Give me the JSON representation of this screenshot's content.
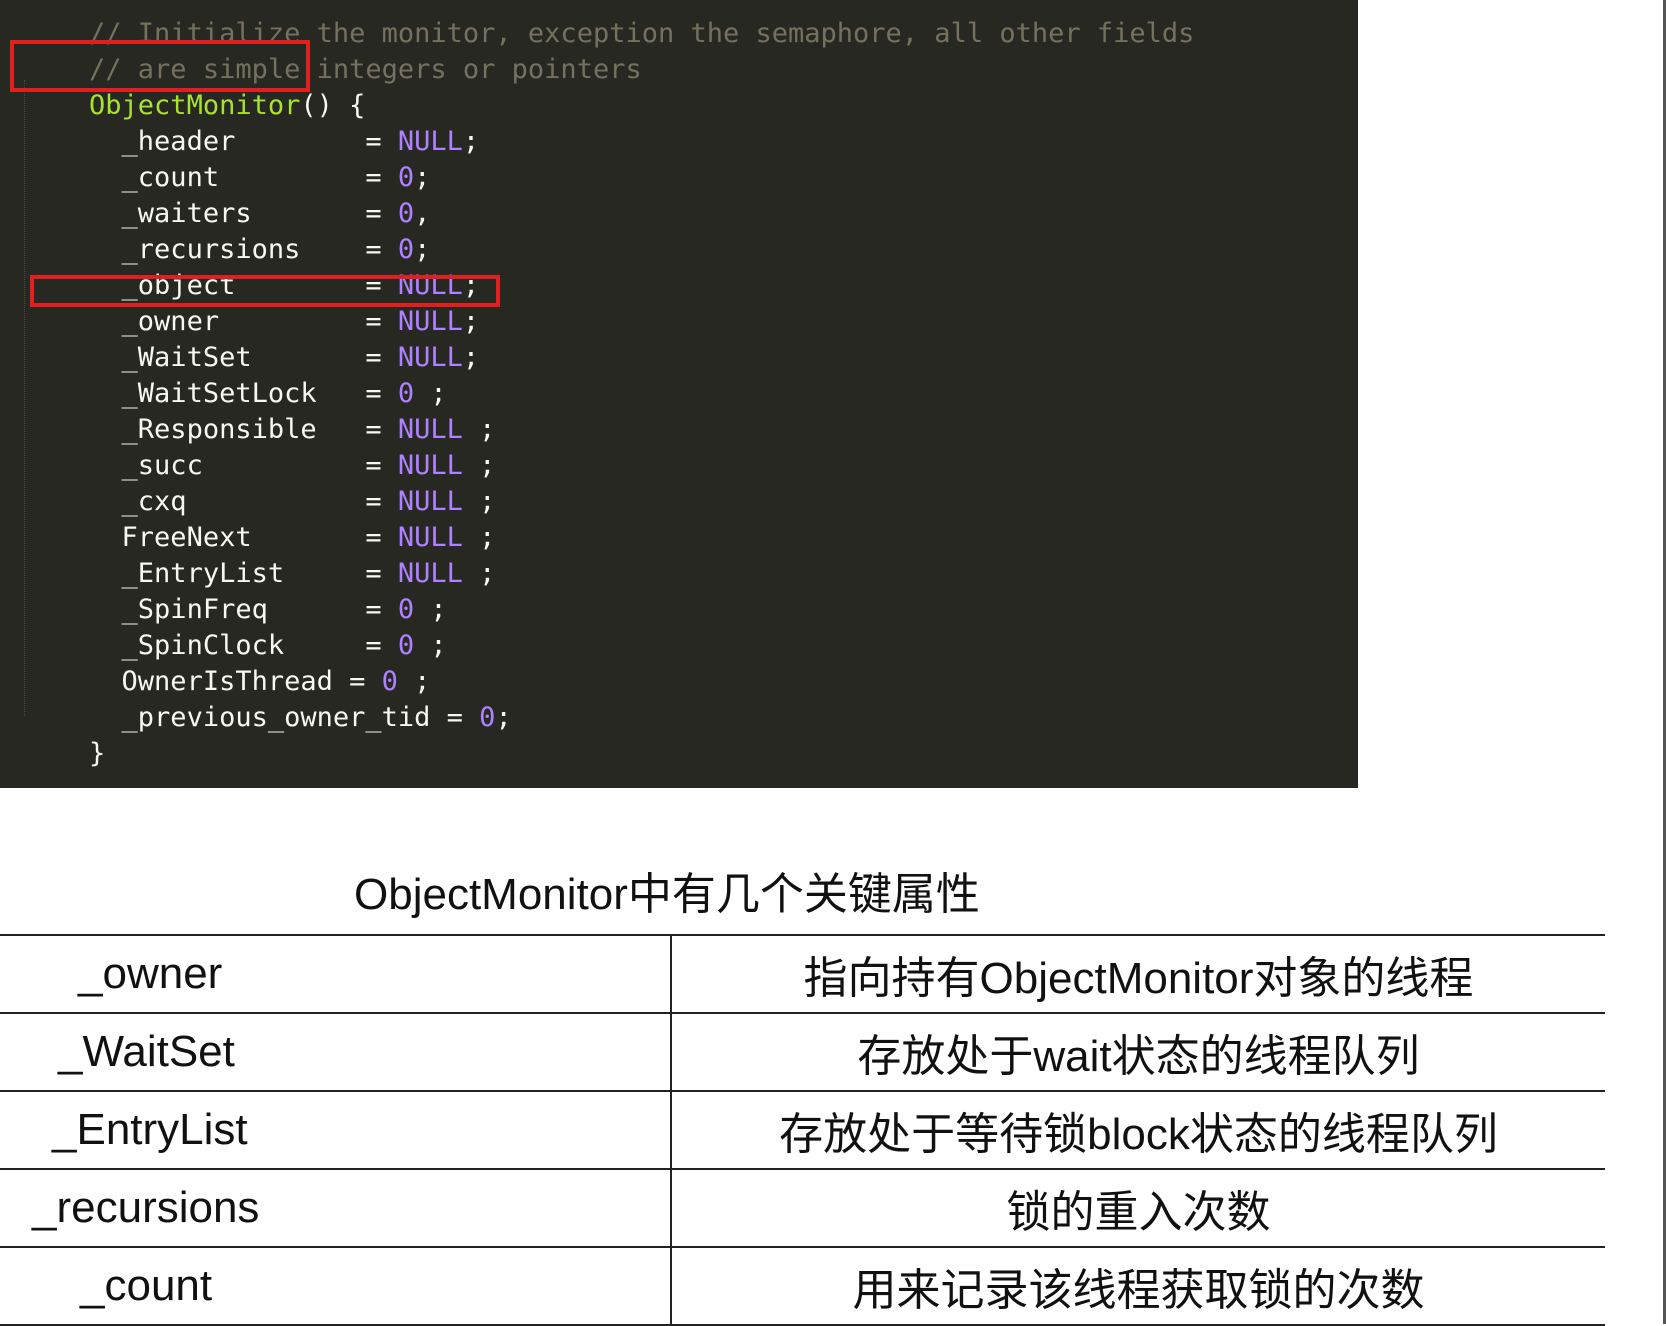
{
  "code": {
    "lines": [
      [
        "// Initialize the monitor, exception the semaphore, all other fields",
        "",
        "",
        "",
        "",
        ""
      ],
      [
        "// are simple integers or pointers",
        "",
        "",
        "",
        "",
        ""
      ],
      [
        "",
        "ObjectMonitor",
        "()",
        " {",
        "",
        ""
      ],
      [
        "",
        "  _header        ",
        "= ",
        "NULL",
        ";",
        ""
      ],
      [
        "",
        "  _count         ",
        "= ",
        "0",
        ";",
        ""
      ],
      [
        "",
        "  _waiters       ",
        "= ",
        "0",
        ",",
        ""
      ],
      [
        "",
        "  _recursions    ",
        "= ",
        "0",
        ";",
        ""
      ],
      [
        "",
        "  _object        ",
        "= ",
        "NULL",
        ";",
        ""
      ],
      [
        "",
        "  _owner         ",
        "= ",
        "NULL",
        ";",
        ""
      ],
      [
        "",
        "  _WaitSet       ",
        "= ",
        "NULL",
        ";",
        ""
      ],
      [
        "",
        "  _WaitSetLock   ",
        "= ",
        "0",
        " ;",
        ""
      ],
      [
        "",
        "  _Responsible   ",
        "= ",
        "NULL",
        " ;",
        ""
      ],
      [
        "",
        "  _succ          ",
        "= ",
        "NULL",
        " ;",
        ""
      ],
      [
        "",
        "  _cxq           ",
        "= ",
        "NULL",
        " ;",
        ""
      ],
      [
        "",
        "  FreeNext       ",
        "= ",
        "NULL",
        " ;",
        ""
      ],
      [
        "",
        "  _EntryList     ",
        "= ",
        "NULL",
        " ;",
        ""
      ],
      [
        "",
        "  _SpinFreq      ",
        "= ",
        "0",
        " ;",
        ""
      ],
      [
        "",
        "  _SpinClock     ",
        "= ",
        "0",
        " ;",
        ""
      ],
      [
        "",
        "  OwnerIsThread ",
        "= ",
        "0",
        " ;",
        ""
      ],
      [
        "",
        "  _previous_owner_tid ",
        "= ",
        "0",
        ";",
        ""
      ],
      [
        "",
        "}",
        "",
        "",
        "",
        ""
      ]
    ]
  },
  "table": {
    "title": "ObjectMonitor中有几个关键属性",
    "rows": [
      {
        "name": "_owner",
        "desc": "指向持有ObjectMonitor对象的线程"
      },
      {
        "name": "_WaitSet",
        "desc": "存放处于wait状态的线程队列"
      },
      {
        "name": "_EntryList",
        "desc": "存放处于等待锁block状态的线程队列"
      },
      {
        "name": "_recursions",
        "desc": "锁的重入次数"
      },
      {
        "name": "_count",
        "desc": "用来记录该线程获取锁的次数"
      }
    ]
  },
  "colors": {
    "code_background": "#272822",
    "highlight_box": "#e02020",
    "function_name": "#a6e22e",
    "constant": "#ae81ff",
    "comment": "#75715e"
  }
}
